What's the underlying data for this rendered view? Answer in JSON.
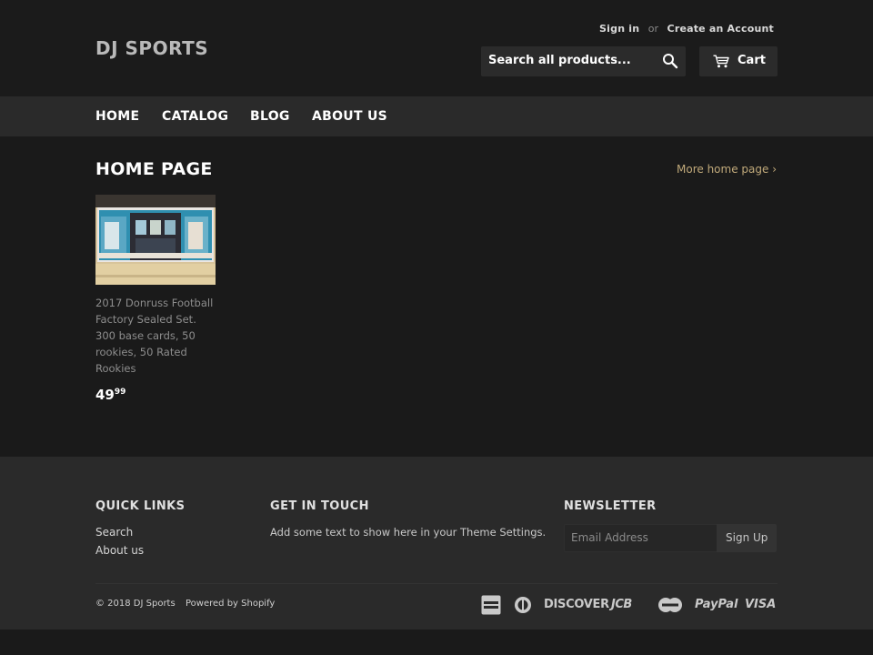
{
  "header": {
    "store_name": "DJ SPORTS",
    "sign_in": "Sign in",
    "or": "or",
    "create_account": "Create an Account",
    "search_placeholder": "Search all products...",
    "cart_label": "Cart"
  },
  "nav": {
    "items": [
      {
        "label": "HOME"
      },
      {
        "label": "CATALOG"
      },
      {
        "label": "BLOG"
      },
      {
        "label": "ABOUT US"
      }
    ]
  },
  "main": {
    "title": "HOME PAGE",
    "more_link": "More home page ›",
    "product": {
      "title": "2017 Donruss Football Factory Sealed Set. 300 base cards, 50 rookies, 50 Rated Rookies",
      "price_whole": "49",
      "price_cents": "99"
    }
  },
  "footer": {
    "quick_links_heading": "QUICK LINKS",
    "quick_links": [
      {
        "label": "Search"
      },
      {
        "label": "About us"
      }
    ],
    "get_in_touch_heading": "GET IN TOUCH",
    "get_in_touch_text": "Add some text to show here in your Theme Settings.",
    "newsletter_heading": "NEWSLETTER",
    "email_placeholder": "Email Address",
    "signup_label": "Sign Up",
    "copyright": "© 2018 DJ Sports",
    "powered_by": "Powered by Shopify",
    "payment_icons": [
      "american-express",
      "diners-club",
      "discover",
      "jcb",
      "master",
      "paypal",
      "visa"
    ],
    "payment_labels": {
      "discover": "DISCOVER",
      "jcb": "JCB",
      "paypal": "PayPal",
      "visa": "VISA"
    }
  },
  "colors": {
    "background": "#1a1a1a",
    "nav_background": "#2a2a2a",
    "accent_link": "#c0a97a"
  }
}
